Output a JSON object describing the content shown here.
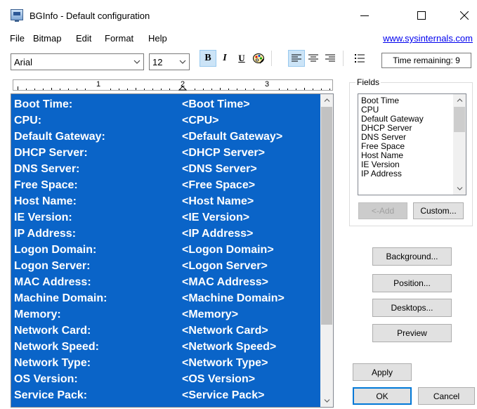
{
  "window": {
    "title": "BGInfo - Default configuration"
  },
  "menu": {
    "items": [
      "File",
      "Bitmap",
      "Edit",
      "Format",
      "Help"
    ],
    "link": "www.sysinternals.com"
  },
  "toolbar": {
    "font_name": "Arial",
    "font_size": "12",
    "bold": "B",
    "italic": "I",
    "underline": "U",
    "time_remaining": "Time remaining: 9"
  },
  "ruler": {
    "marks": [
      "1",
      "2",
      "3"
    ]
  },
  "editor": {
    "rows": [
      {
        "label": "Boot Time:",
        "token": "<Boot Time>"
      },
      {
        "label": "CPU:",
        "token": "<CPU>"
      },
      {
        "label": "Default Gateway:",
        "token": "<Default Gateway>"
      },
      {
        "label": "DHCP Server:",
        "token": "<DHCP Server>"
      },
      {
        "label": "DNS Server:",
        "token": "<DNS Server>"
      },
      {
        "label": "Free Space:",
        "token": "<Free Space>"
      },
      {
        "label": "Host Name:",
        "token": "<Host Name>"
      },
      {
        "label": "IE Version:",
        "token": "<IE Version>"
      },
      {
        "label": "IP Address:",
        "token": "<IP Address>"
      },
      {
        "label": "Logon Domain:",
        "token": "<Logon Domain>"
      },
      {
        "label": "Logon Server:",
        "token": "<Logon Server>"
      },
      {
        "label": "MAC Address:",
        "token": "<MAC Address>"
      },
      {
        "label": "Machine Domain:",
        "token": "<Machine Domain>"
      },
      {
        "label": "Memory:",
        "token": "<Memory>"
      },
      {
        "label": "Network Card:",
        "token": "<Network Card>"
      },
      {
        "label": "Network Speed:",
        "token": "<Network Speed>"
      },
      {
        "label": "Network Type:",
        "token": "<Network Type>"
      },
      {
        "label": "OS Version:",
        "token": "<OS Version>"
      },
      {
        "label": "Service Pack:",
        "token": "<Service Pack>"
      }
    ]
  },
  "fields": {
    "label": "Fields",
    "items": [
      "Boot Time",
      "CPU",
      "Default Gateway",
      "DHCP Server",
      "DNS Server",
      "Free Space",
      "Host Name",
      "IE Version",
      "IP Address"
    ],
    "add_label": "<-Add",
    "custom_label": "Custom..."
  },
  "buttons": {
    "background": "Background...",
    "position": "Position...",
    "desktops": "Desktops...",
    "preview": "Preview",
    "apply": "Apply",
    "ok": "OK",
    "cancel": "Cancel"
  },
  "colors": {
    "selection": "#0a64c8",
    "link": "#0000ee"
  }
}
